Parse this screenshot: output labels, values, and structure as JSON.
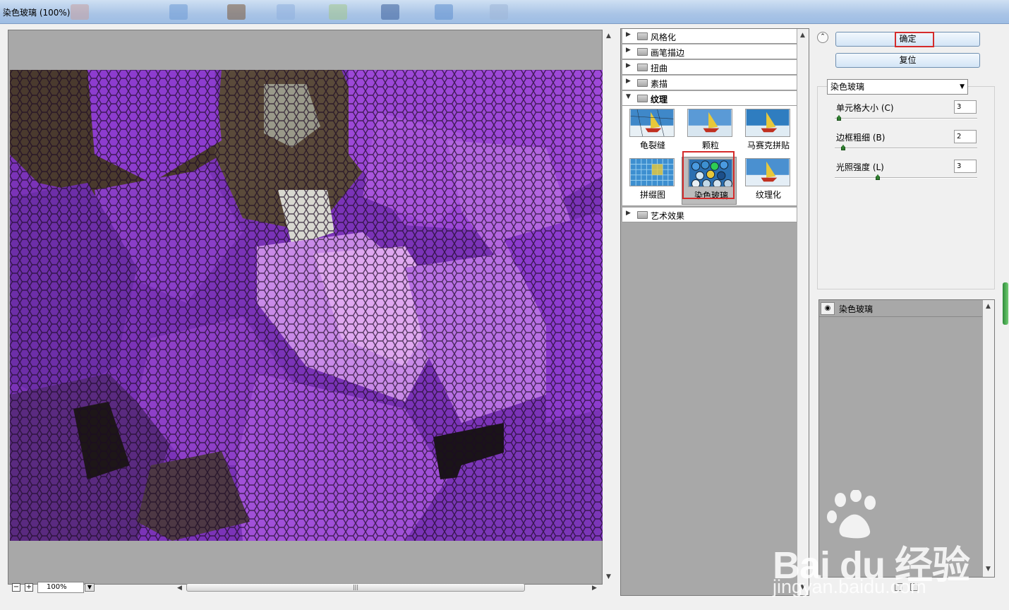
{
  "window": {
    "title": "染色玻璃 (100%)"
  },
  "colors": {
    "accent_red": "#d42b2b",
    "preview_bg": "#a8a8a8",
    "flower_purple": "#9b45d6"
  },
  "preview": {
    "zoom": "100%"
  },
  "filter_gallery": {
    "categories_top": [
      {
        "label": "风格化",
        "expanded": false
      },
      {
        "label": "画笔描边",
        "expanded": false
      },
      {
        "label": "扭曲",
        "expanded": false
      },
      {
        "label": "素描",
        "expanded": false
      },
      {
        "label": "纹理",
        "expanded": true
      }
    ],
    "texture_filters": [
      {
        "label": "龟裂缝",
        "icon": "craquelure-thumbnail"
      },
      {
        "label": "颗粒",
        "icon": "grain-thumbnail"
      },
      {
        "label": "马赛克拼贴",
        "icon": "mosaic-tiles-thumbnail"
      },
      {
        "label": "拼缀图",
        "icon": "patchwork-thumbnail"
      },
      {
        "label": "染色玻璃",
        "icon": "stained-glass-thumbnail",
        "selected": true
      },
      {
        "label": "纹理化",
        "icon": "texturizer-thumbnail"
      }
    ],
    "categories_bottom": [
      {
        "label": "艺术效果",
        "expanded": false
      }
    ]
  },
  "buttons": {
    "ok": "确定",
    "reset": "复位"
  },
  "settings": {
    "filter_select": "染色玻璃",
    "params": [
      {
        "label": "单元格大小 (C)",
        "value": "3",
        "level": 0.03
      },
      {
        "label": "边框粗细 (B)",
        "value": "2",
        "level": 0.06
      },
      {
        "label": "光照强度 (L)",
        "value": "3",
        "level": 0.3
      }
    ]
  },
  "layers": {
    "items": [
      {
        "label": "染色玻璃",
        "visible": true
      }
    ]
  },
  "watermark": {
    "brand": "Bai du 经验",
    "url": "jingyan.baidu.com"
  }
}
